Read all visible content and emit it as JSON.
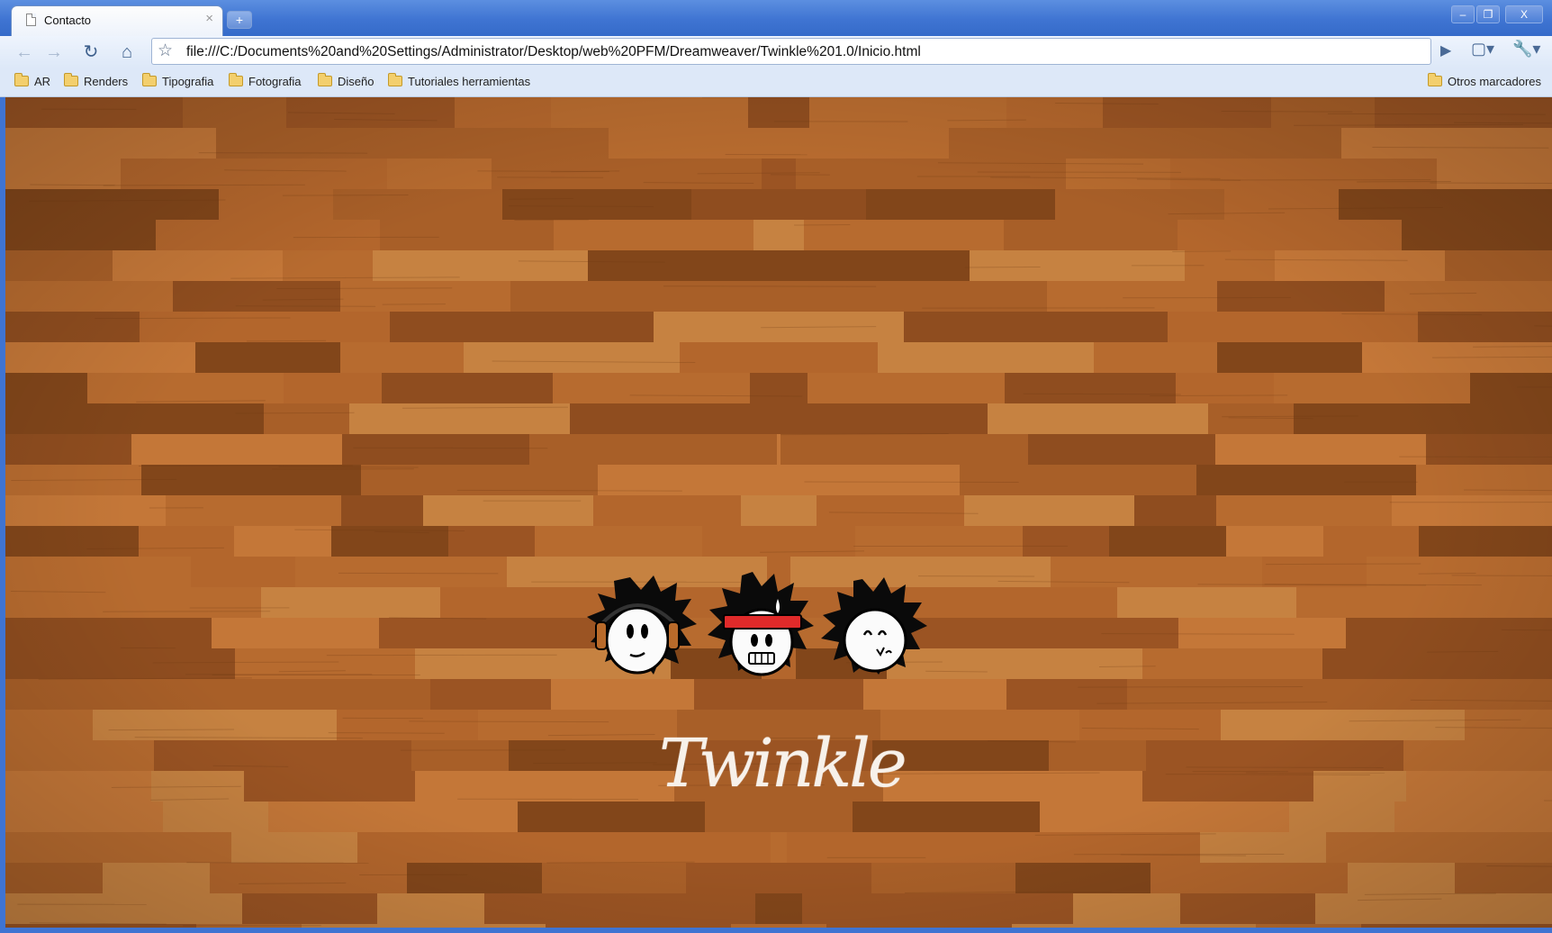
{
  "browser": {
    "tab_title": "Contacto",
    "tab_close": "×",
    "new_tab": "+",
    "window_controls": [
      "–",
      "❐",
      "X"
    ],
    "url": "file:///C:/Documents%20and%20Settings/Administrator/Desktop/web%20PFM/Dreamweaver/Twinkle%201.0/Inicio.html",
    "nav": {
      "back_icon": "←",
      "forward_icon": "→",
      "reload_icon": "↻",
      "home_icon": "⌂",
      "star_icon": "☆",
      "go_icon": "▶",
      "page_menu_icon": "▢▾",
      "wrench_icon": "🔧▾"
    },
    "bookmarks": [
      "AR",
      "Renders",
      "Tipografia",
      "Fotografia",
      "Diseño",
      "Tutoriales herramientas"
    ],
    "other_bookmarks": "Otros marcadores"
  },
  "page": {
    "logo_text": "Twinkle",
    "characters": [
      "headphones-character",
      "headband-character",
      "smiling-character"
    ],
    "colors": {
      "wood_light": "#c77a3a",
      "wood_mid": "#a85f28",
      "wood_dark": "#7f4419",
      "headband_red": "#e02a2a"
    }
  }
}
